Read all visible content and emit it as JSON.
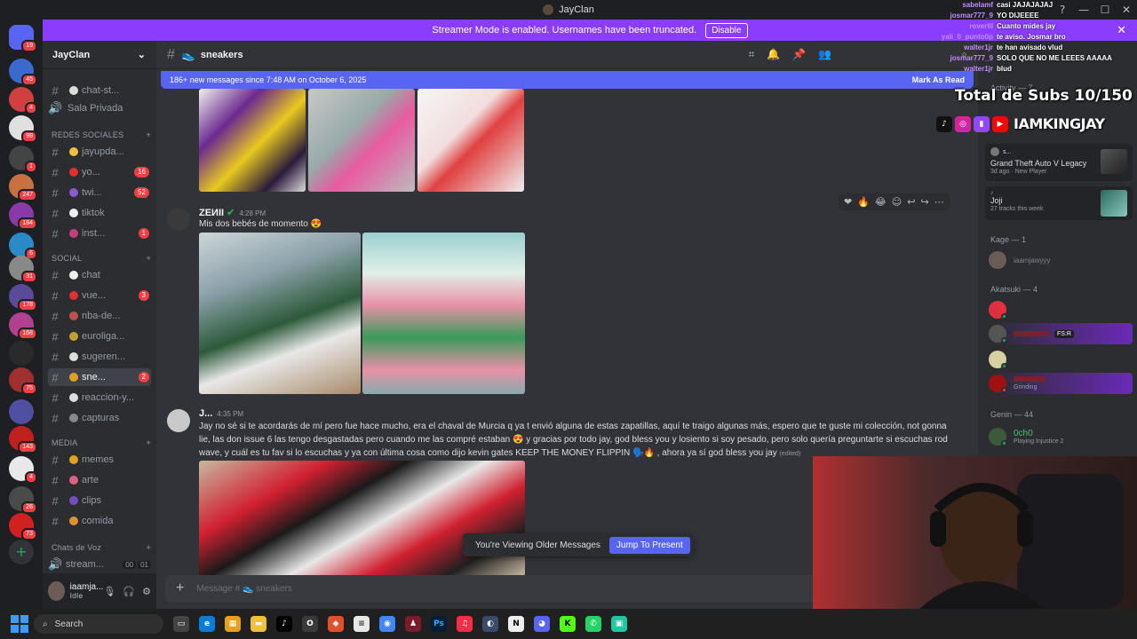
{
  "window": {
    "title": "JayClan"
  },
  "banner": {
    "text": "Streamer Mode is enabled. Usernames have been truncated.",
    "button": "Disable"
  },
  "servers": [
    {
      "badge": "19"
    },
    {
      "badge": "45"
    },
    {
      "badge": "4"
    },
    {
      "badge": "99"
    },
    {
      "badge": "1"
    },
    {
      "badge": "247"
    },
    {
      "badge": "184"
    },
    {
      "badge": "6"
    },
    {
      "badge": "31"
    },
    {
      "badge": "178"
    },
    {
      "badge": "168"
    },
    {
      "badge": ""
    },
    {
      "badge": "75"
    },
    {
      "badge": ""
    },
    {
      "badge": "143"
    },
    {
      "badge": "4"
    },
    {
      "badge": "26"
    },
    {
      "badge": "73"
    }
  ],
  "sidebar": {
    "guild": "JayClan",
    "top_channels": [
      {
        "label": "chat-st..."
      },
      {
        "label": "Sala Privada"
      }
    ],
    "categories": {
      "redes": "REDES SOCIALES",
      "social": "SOCIAL",
      "media": "MEDIA",
      "voz": "Chats de Voz"
    },
    "redes_channels": [
      {
        "label": "jayupda...",
        "count": ""
      },
      {
        "label": "yo...",
        "count": "16"
      },
      {
        "label": "twi...",
        "count": "52"
      },
      {
        "label": "tiktok",
        "count": ""
      },
      {
        "label": "inst...",
        "count": "1"
      }
    ],
    "social_channels": [
      {
        "label": "chat",
        "count": ""
      },
      {
        "label": "vue...",
        "count": "3"
      },
      {
        "label": "nba-de...",
        "count": ""
      },
      {
        "label": "euroliga...",
        "count": ""
      },
      {
        "label": "sugeren...",
        "count": ""
      },
      {
        "label": "sne...",
        "count": "2"
      },
      {
        "label": "reaccion-y...",
        "count": ""
      },
      {
        "label": "capturas",
        "count": ""
      }
    ],
    "media_channels": [
      {
        "label": "memes"
      },
      {
        "label": "arte"
      },
      {
        "label": "clips"
      },
      {
        "label": "comida"
      }
    ],
    "voice": {
      "label": "stream...",
      "a": "00",
      "b": "01"
    }
  },
  "user": {
    "name": "iaamja...",
    "status": "Idle"
  },
  "channel": {
    "name": "sneakers"
  },
  "newbar": {
    "text": "186+ new messages since 7:48 AM on October 6, 2025",
    "action": "Mark As Read"
  },
  "messages": [
    {
      "author": "ZEИII",
      "time": "4:28 PM",
      "text": "Mis dos bebés de momento 😍"
    },
    {
      "author": "J...",
      "time": "4:35 PM",
      "text": "Jay no sé si te acordarás de mí pero fue hace mucho, era el chaval de Murcia q ya t envió alguna de estas zapatillas, aquí te traigo algunas más, espero que te guste mi colección, not gonna lie, las don issue 6 las tengo desgastadas pero cuando me las compré estaban 😍 y gracias por todo jay, god bless you y losiento si soy pesado, pero solo quería preguntarte si escuchas rod wave, y cuál es tu fav si lo escuchas y ya con última cosa como dijo kevin gates KEEP THE MONEY FLIPPIN 🗣️🔥 , ahora ya sí god bless you jay",
      "edited": "(edited)"
    }
  ],
  "older": {
    "text": "You're Viewing Older Messages",
    "button": "Jump To Present"
  },
  "composer": {
    "placeholder": "Message # 👟 sneakers"
  },
  "members": {
    "activity_label": "Activity — 7",
    "cards": [
      {
        "user": "s...",
        "title": "Grand Theft Auto V Legacy",
        "sub": "3d ago · New Player"
      },
      {
        "user": "",
        "title": "Joji",
        "sub": "27 tracks this week"
      }
    ],
    "kage_label": "Kage — 1",
    "kage": [
      {
        "name": "iaamjawyyy"
      }
    ],
    "akatsuki_label": "Akatsuki — 4",
    "akatsuki": [
      {
        "name": "",
        "sub": ""
      },
      {
        "name": "",
        "tag": "FS:R"
      },
      {
        "name": "",
        "sub": ""
      },
      {
        "name": "",
        "sub": "Grinding"
      }
    ],
    "genin_label": "Genin — 44",
    "genin": [
      {
        "name": "0ch0",
        "sub": "Playing Injustice 2"
      }
    ]
  },
  "overlay_chat": [
    {
      "user": "sabelamf",
      "text": "casi JAJAJAJAJ"
    },
    {
      "user": "josmar777_9",
      "text": "YO DIJEEEE"
    },
    {
      "user": "roverlll",
      "text": "Cuanto mides jay"
    },
    {
      "user": "yali_0_punto0p",
      "text": "te aviso. Josmar bro"
    },
    {
      "user": "walter1jr",
      "text": "te han avisado vlud"
    },
    {
      "user": "josmar777_9",
      "text": "SOLO QUE NO ME LEEES AAAAA"
    },
    {
      "user": "walter1jr",
      "text": "blud"
    }
  ],
  "overlay": {
    "subs": "Total de Subs 10/150",
    "brand": "IAMKINGJAY"
  },
  "taskbar": {
    "search": "Search"
  },
  "colors": {
    "blurple": "#5865f2",
    "banner": "#8b3dff",
    "red": "#f23f43",
    "green": "#23a55a"
  }
}
